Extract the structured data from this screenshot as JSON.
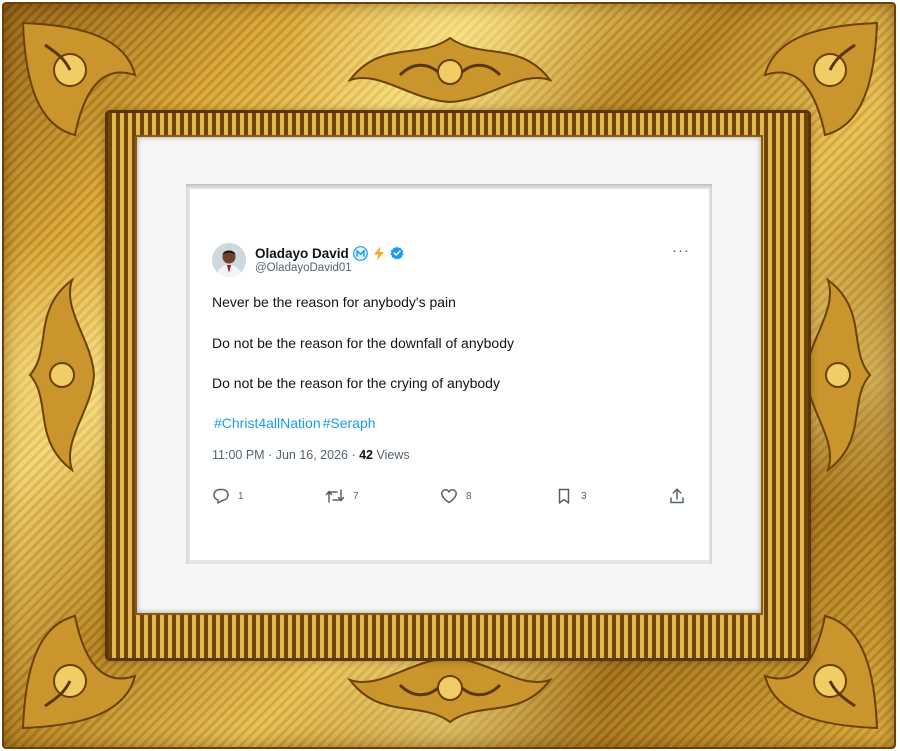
{
  "tweet": {
    "author_name": "Oladayo David",
    "handle": "@OladayoDavid01",
    "more_menu": "···",
    "lines": [
      "Never be the reason for anybody's pain",
      "Do not be the reason for the downfall of anybody",
      "Do not be the reason for the crying of anybody"
    ],
    "hashtags": [
      "#Christ4allNation",
      "#Seraph"
    ],
    "time": "11:00 PM",
    "date": "Jun 16, 2026",
    "views_count": "42",
    "views_label": "Views",
    "metrics": {
      "replies": "1",
      "reposts": "7",
      "likes": "8",
      "bookmarks": "3"
    }
  },
  "icons": {
    "badge_m": "m-circle-badge-icon",
    "badge_lightning": "lightning-icon",
    "verified": "verified-badge-icon",
    "reply": "reply-icon",
    "repost": "repost-icon",
    "like": "heart-icon",
    "bookmark": "bookmark-icon",
    "share": "share-icon"
  },
  "colors": {
    "link_blue": "#1d9bf0",
    "secondary_text": "#536471",
    "primary_text": "#0f1419",
    "lightning": "#f6a91b",
    "frame_gold": "#d9a534"
  }
}
